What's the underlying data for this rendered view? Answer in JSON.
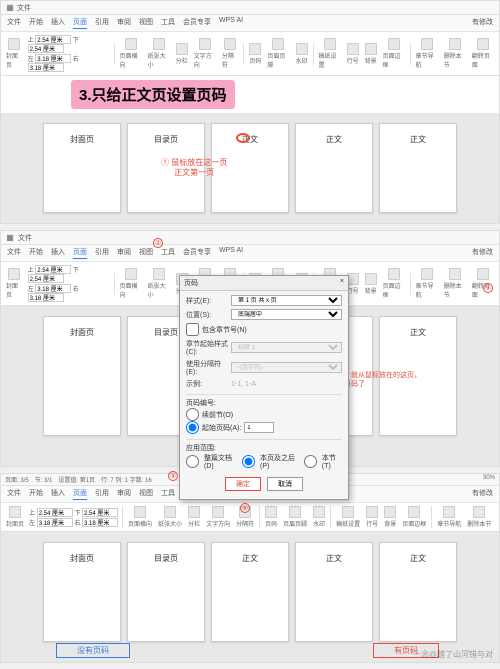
{
  "banner": "3.只给正文页设置页码",
  "menu": {
    "file": "文件",
    "items": [
      "开始",
      "插入",
      "页面",
      "引用",
      "审阅",
      "视图",
      "工具",
      "会员专享"
    ],
    "wpsai": "WPS AI",
    "share": "有修改"
  },
  "ribbon": {
    "vals": {
      "top": "2.54 厘米",
      "left": "3.18 厘米",
      "top2": "2.54 厘米",
      "left2": "3.18 厘米"
    },
    "groups": [
      "封面页",
      "目录页",
      "页面横向",
      "纸张大小",
      "分栏",
      "文字方向",
      "分隔符",
      "页码",
      "页眉页脚",
      "水印",
      "稿纸设置",
      "行号",
      "背景",
      "页面边框",
      "章节导航",
      "删除本节",
      "翻转页面"
    ]
  },
  "status": {
    "page": "页面: 3/5",
    "section": "节: 3/1",
    "cursor": "设置值: 第1页",
    "wc": "行: 7  列: 1  字数: 16",
    "zoom": "30%"
  },
  "pages": {
    "p1": "封面页",
    "p2": "目录页",
    "p3": "正文",
    "p4": "正文",
    "p5": "正文"
  },
  "anno": {
    "a1": "① 鼠标放在这一页\n正文第一页",
    "a7": "这里选择本页及之后，就从鼠标放在的这页，\n也就是正文页开始编页码了",
    "nopg": "没有页码",
    "haspg": "有页码"
  },
  "dialog": {
    "title": "页码",
    "style_lbl": "样式(E):",
    "style_val": "第 1 页 共 x 页",
    "pos_lbl": "位置(S):",
    "pos_val": "底端居中",
    "chap_chk": "包含章节号(N)",
    "chap_style_lbl": "章节起始样式(C):",
    "chap_style_val": "标题 1",
    "sep_lbl": "使用分隔符(E):",
    "sep_val": "-(连字符)",
    "example_lbl": "示例:",
    "example_val": "1-1, 1-A",
    "numbering": "页码编号:",
    "continue": "续前节(O)",
    "startat": "起始页码(A):",
    "startval": "1",
    "apply": "应用范围:",
    "whole": "整篇文档(D)",
    "frompage": "本页及之后(P)",
    "section": "本节(T)",
    "ok": "确定",
    "cancel": "取消"
  },
  "watermark": "一念@踏了山河错与对"
}
